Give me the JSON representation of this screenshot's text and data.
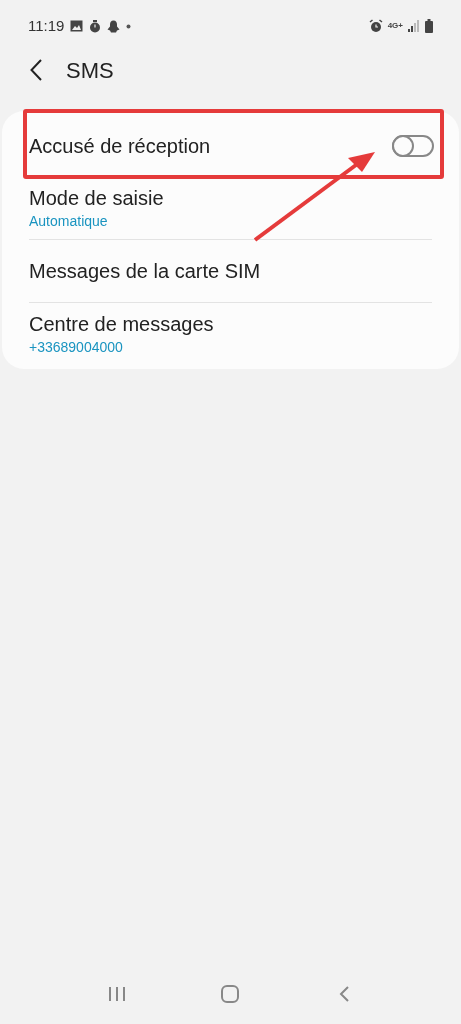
{
  "status_bar": {
    "time": "11:19",
    "network": "4G+"
  },
  "header": {
    "title": "SMS"
  },
  "items": [
    {
      "kind": "toggle",
      "title": "Accusé de réception",
      "on": false,
      "highlighted": true
    },
    {
      "kind": "text",
      "title": "Mode de saisie",
      "subtitle": "Automatique"
    },
    {
      "kind": "text",
      "title": "Messages de la carte SIM"
    },
    {
      "kind": "text",
      "title": "Centre de messages",
      "subtitle": "+33689004000"
    }
  ]
}
